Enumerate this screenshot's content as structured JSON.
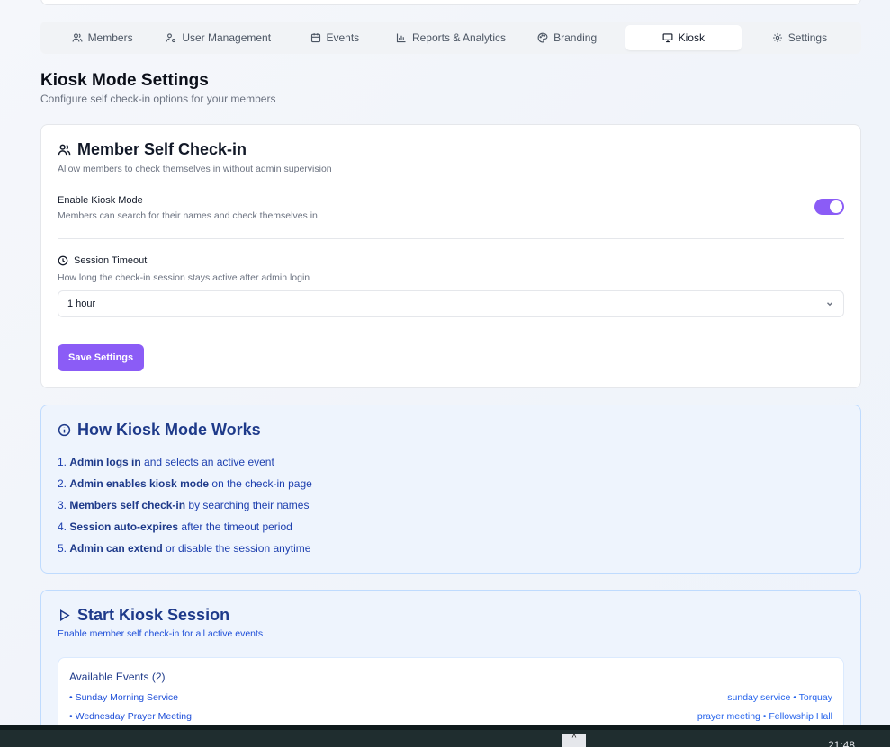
{
  "tabs": [
    {
      "label": "Members",
      "icon": "users-icon"
    },
    {
      "label": "User Management",
      "icon": "user-cog-icon"
    },
    {
      "label": "Events",
      "icon": "calendar-icon"
    },
    {
      "label": "Reports & Analytics",
      "icon": "bar-chart-icon"
    },
    {
      "label": "Branding",
      "icon": "palette-icon"
    },
    {
      "label": "Kiosk",
      "icon": "monitor-icon",
      "active": true
    },
    {
      "label": "Settings",
      "icon": "gear-icon"
    }
  ],
  "page": {
    "title": "Kiosk Mode Settings",
    "subtitle": "Configure self check-in options for your members"
  },
  "self_checkin": {
    "title": "Member Self Check-in",
    "description": "Allow members to check themselves in without admin supervision",
    "enable_label": "Enable Kiosk Mode",
    "enable_description": "Members can search for their names and check themselves in",
    "enabled": true,
    "timeout_label": "Session Timeout",
    "timeout_description": "How long the check-in session stays active after admin login",
    "timeout_value": "1 hour",
    "save_label": "Save Settings"
  },
  "how_it_works": {
    "title": "How Kiosk Mode Works",
    "steps": [
      {
        "num": "1.",
        "bold": "Admin logs in",
        "rest": " and selects an active event"
      },
      {
        "num": "2.",
        "bold": "Admin enables kiosk mode",
        "rest": " on the check-in page"
      },
      {
        "num": "3.",
        "bold": "Members self check-in",
        "rest": " by searching their names"
      },
      {
        "num": "4.",
        "bold": "Session auto-expires",
        "rest": " after the timeout period"
      },
      {
        "num": "5.",
        "bold": "Admin can extend",
        "rest": " or disable the session anytime"
      }
    ]
  },
  "start_session": {
    "title": "Start Kiosk Session",
    "description": "Enable member self check-in for all active events",
    "events_title": "Available Events (2)",
    "events": [
      {
        "name": "• Sunday Morning Service",
        "meta": "sunday service • Torquay"
      },
      {
        "name": "• Wednesday Prayer Meeting",
        "meta": "prayer meeting • Fellowship Hall"
      }
    ]
  },
  "taskbar": {
    "tray_arrow": "^",
    "clock": "21:48"
  },
  "colors": {
    "accent": "#8b5cf6",
    "info_blue": "#1e3a8a"
  }
}
